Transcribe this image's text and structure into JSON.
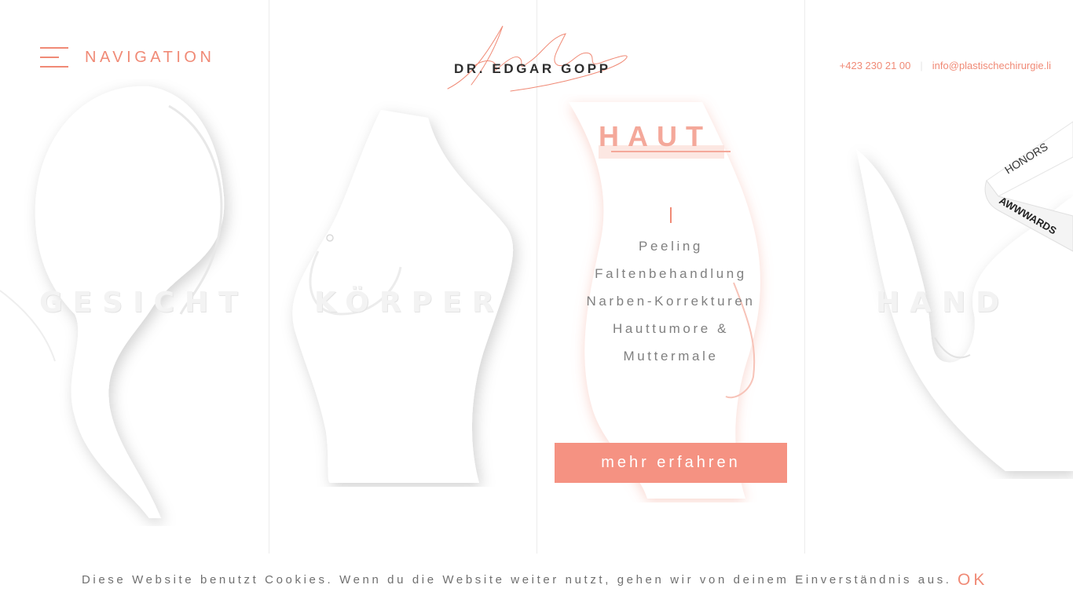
{
  "header": {
    "nav_label": "NAVIGATION",
    "brand_name": "DR. EDGAR GOPP",
    "phone": "+423 230 21 00",
    "email": "info@plastischechirurgie.li"
  },
  "columns": [
    {
      "title": "GESICHT"
    },
    {
      "title": "KÖRPER"
    },
    {
      "title": "HAUT"
    },
    {
      "title": "HAND"
    }
  ],
  "active": {
    "title": "HAUT",
    "items": [
      "Peeling",
      "Faltenbehandlung",
      "Narben-Korrekturen",
      "Hauttumore &",
      "Muttermale"
    ],
    "cta_label": "mehr erfahren"
  },
  "ribbon": {
    "top_text": "HONORS",
    "bottom_text": "AWWWARDS"
  },
  "cookie": {
    "text": "Diese Website benutzt Cookies. Wenn du die Website weiter nutzt, gehen wir von deinem Einverständnis aus.",
    "ok_label": "OK"
  },
  "colors": {
    "accent": "#f08a76",
    "button": "#f59282",
    "text": "#707070"
  }
}
